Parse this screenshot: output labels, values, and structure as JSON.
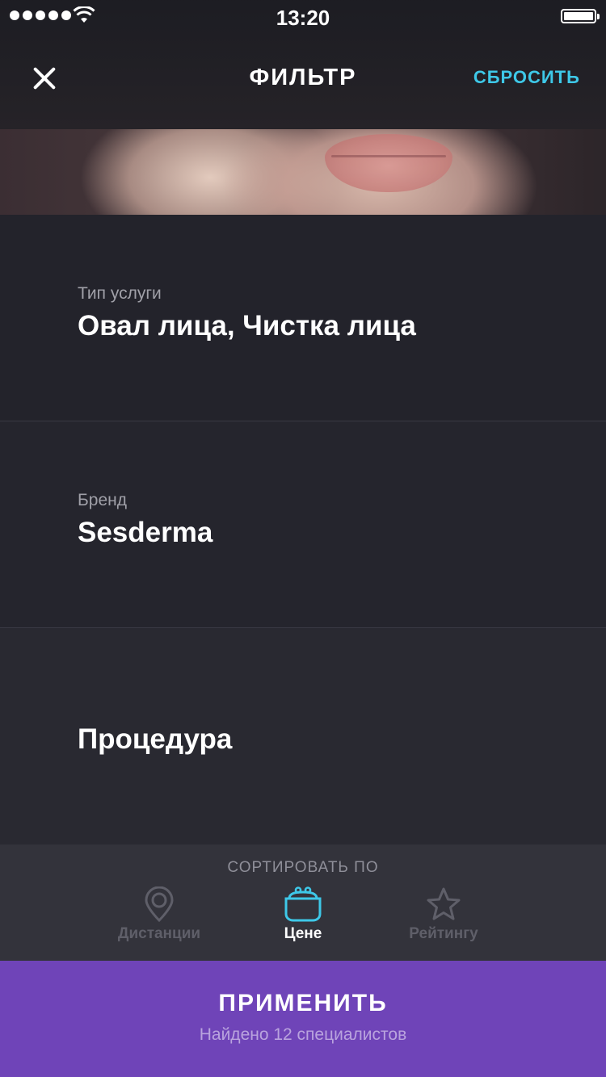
{
  "status_bar": {
    "time": "13:20"
  },
  "nav": {
    "title": "ФИЛЬТР",
    "reset_label": "СБРОСИТЬ"
  },
  "filters": [
    {
      "label": "Тип услуги",
      "value": "Овал лица, Чистка лица"
    },
    {
      "label": "Бренд",
      "value": "Sesderma"
    },
    {
      "label": "",
      "value": "Процедура"
    }
  ],
  "sort": {
    "title": "СОРТИРОВАТЬ ПО",
    "options": [
      {
        "label": "Дистанции",
        "icon": "location-pin-icon",
        "active": false
      },
      {
        "label": "Цене",
        "icon": "purse-icon",
        "active": true
      },
      {
        "label": "Рейтингу",
        "icon": "star-icon",
        "active": false
      }
    ]
  },
  "apply": {
    "label": "ПРИМЕНИТЬ",
    "subtitle": "Найдено 12 специалистов"
  },
  "colors": {
    "accent": "#3ec8e8",
    "primary": "#6f44b8",
    "background": "#23232b"
  }
}
